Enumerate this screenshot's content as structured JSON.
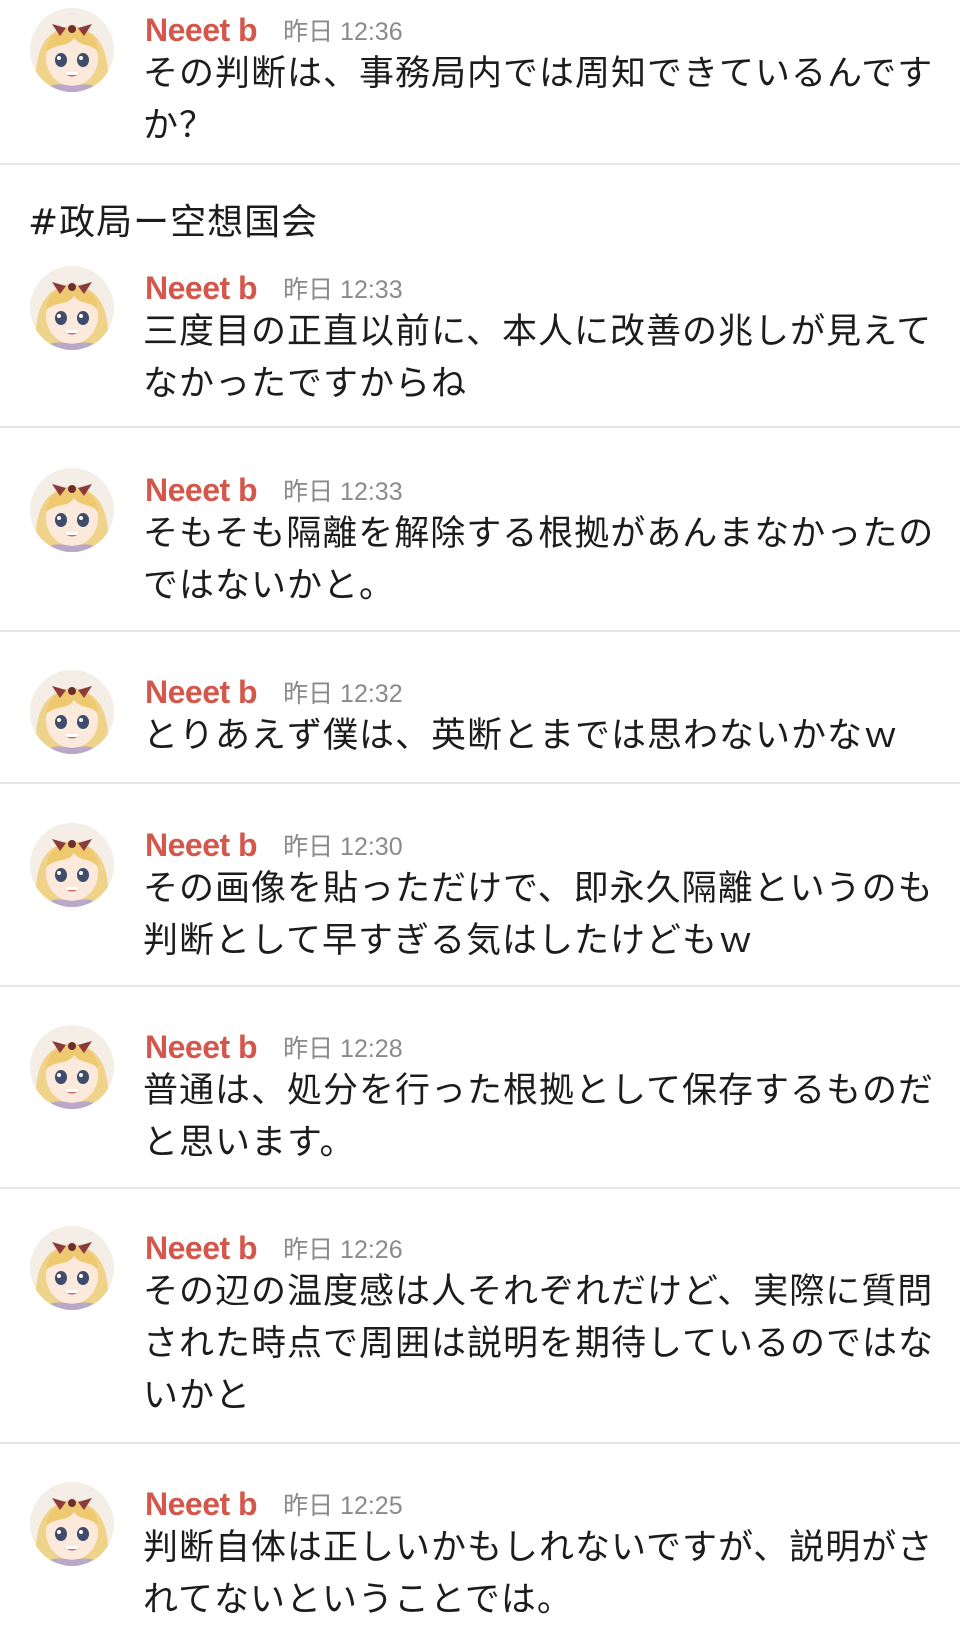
{
  "colors": {
    "username": "#d3574a",
    "timestamp": "#8a8a8a",
    "divider": "#e6e6e6"
  },
  "channel": {
    "title": "#政局ー空想国会"
  },
  "messages": [
    {
      "user": "Neeet b",
      "time": "昨日 12:36",
      "text": "その判断は、事務局内では周知できているんですか？"
    },
    {
      "user": "Neeet b",
      "time": "昨日 12:33",
      "text": "三度目の正直以前に、本人に改善の兆しが見えてなかったですからね"
    },
    {
      "user": "Neeet b",
      "time": "昨日 12:33",
      "text": "そもそも隔離を解除する根拠があんまなかったのではないかと。"
    },
    {
      "user": "Neeet b",
      "time": "昨日 12:32",
      "text": "とりあえず僕は、英断とまでは思わないかなｗ"
    },
    {
      "user": "Neeet b",
      "time": "昨日 12:30",
      "text": "その画像を貼っただけで、即永久隔離というのも判断として早すぎる気はしたけどもｗ"
    },
    {
      "user": "Neeet b",
      "time": "昨日 12:28",
      "text": "普通は、処分を行った根拠として保存するものだと思います。"
    },
    {
      "user": "Neeet b",
      "time": "昨日 12:26",
      "text": "その辺の温度感は人それぞれだけど、実際に質問された時点で周囲は説明を期待しているのではないかと"
    },
    {
      "user": "Neeet b",
      "time": "昨日 12:25",
      "text": "判断自体は正しいかもしれないですが、説明がされてないということでは。"
    }
  ]
}
